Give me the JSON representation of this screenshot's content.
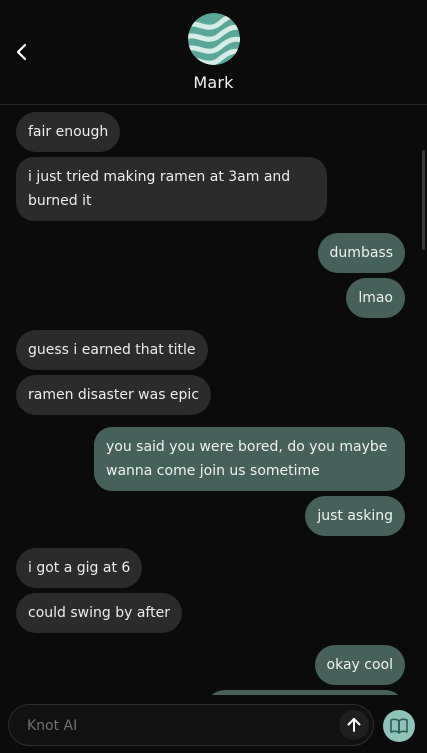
{
  "header": {
    "contact_name": "Mark",
    "back_icon": "chevron-left-icon",
    "avatar_colors": [
      "#5aa79a",
      "#cfe6e0"
    ]
  },
  "messages": [
    {
      "from": "them",
      "text": "fair enough"
    },
    {
      "from": "them",
      "text": "i just tried making ramen at 3am and burned it"
    },
    {
      "from": "me",
      "text": "dumbass"
    },
    {
      "from": "me",
      "text": "lmao"
    },
    {
      "from": "them",
      "text": "guess i earned that title"
    },
    {
      "from": "them",
      "text": "ramen disaster was epic"
    },
    {
      "from": "me",
      "text": "you said you were bored, do you maybe wanna come join us sometime"
    },
    {
      "from": "me",
      "text": "just asking"
    },
    {
      "from": "them",
      "text": "i got a gig at 6"
    },
    {
      "from": "them",
      "text": "could swing by after"
    },
    {
      "from": "me",
      "text": "okay cool"
    }
  ],
  "composer": {
    "placeholder": "Knot AI",
    "send_icon": "arrow-up-icon",
    "book_icon": "book-icon"
  },
  "colors": {
    "background": "#0b0b0b",
    "incoming_bubble": "#2b2b2b",
    "outgoing_bubble": "#46605a",
    "book_button": "#8fc3b8"
  }
}
